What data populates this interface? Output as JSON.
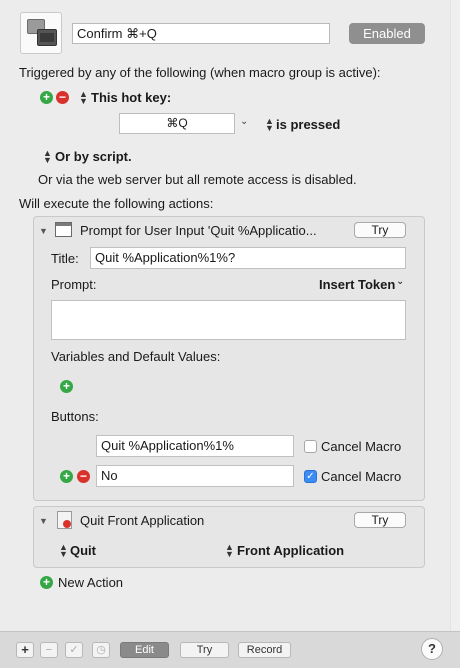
{
  "header": {
    "macro_name": "Confirm ⌘+Q",
    "enabled_label": "Enabled"
  },
  "triggers": {
    "intro": "Triggered by any of the following (when macro group is active):",
    "hot_key_label": "This hot key:",
    "hot_key_value": "⌘Q",
    "hot_key_condition": "is pressed",
    "script_label": "Or by script.",
    "web_server_note": "Or via the web server but all remote access is disabled."
  },
  "actions_intro": "Will execute the following actions:",
  "action1": {
    "title": "Prompt for User Input 'Quit %Applicatio...",
    "try_label": "Try",
    "title_field_label": "Title:",
    "title_field_value": "Quit %Application%1%?",
    "prompt_label": "Prompt:",
    "insert_token_label": "Insert Token",
    "prompt_value": "",
    "variables_label": "Variables and Default Values:",
    "buttons_label": "Buttons:",
    "buttons": [
      {
        "value": "Quit %Application%1%",
        "cancel_label": "Cancel Macro",
        "cancel_checked": false
      },
      {
        "value": "No",
        "cancel_label": "Cancel Macro",
        "cancel_checked": true
      }
    ]
  },
  "action2": {
    "title": "Quit Front Application",
    "try_label": "Try",
    "verb": "Quit",
    "target": "Front Application"
  },
  "new_action_label": "New Action",
  "toolbar": {
    "edit_label": "Edit",
    "try_label": "Try",
    "record_label": "Record",
    "help_label": "?"
  },
  "colors": {
    "add_green": "#35a745",
    "remove_red": "#d9322d",
    "checkbox_blue": "#3c8cf5",
    "enabled_button": "#8f8f8f"
  },
  "icons": {
    "macro_group_icon": "stacked-windows-icon",
    "action1_icon": "window-icon",
    "action2_icon": "quit-app-icon",
    "disclosure": "disclosure-triangle-icon"
  }
}
